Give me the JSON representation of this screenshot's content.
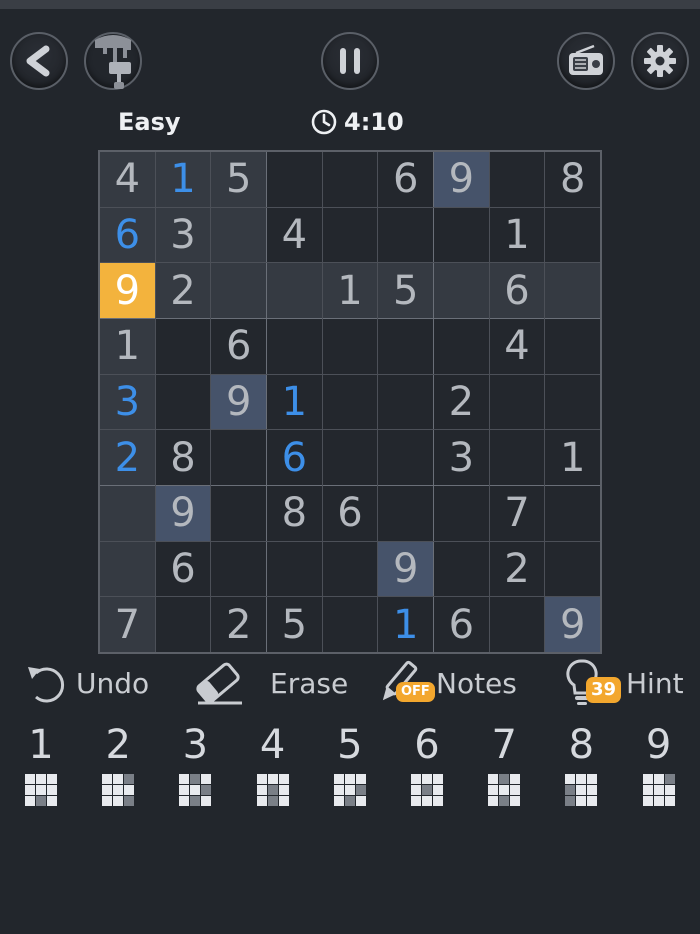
{
  "header": {
    "difficulty": "Easy",
    "timer": "4:10"
  },
  "board": {
    "rows": [
      [
        "4",
        "1",
        "5",
        "",
        "",
        "6",
        "9",
        "",
        "8"
      ],
      [
        "6",
        "3",
        "",
        "4",
        "",
        "",
        "",
        "1",
        ""
      ],
      [
        "9",
        "2",
        "",
        "",
        "1",
        "5",
        "",
        "6",
        ""
      ],
      [
        "1",
        "",
        "6",
        "",
        "",
        "",
        "",
        "4",
        ""
      ],
      [
        "3",
        "",
        "9",
        "1",
        "",
        "",
        "2",
        "",
        ""
      ],
      [
        "2",
        "8",
        "",
        "6",
        "",
        "",
        "3",
        "",
        "1"
      ],
      [
        "",
        "9",
        "",
        "8",
        "6",
        "",
        "",
        "7",
        ""
      ],
      [
        "",
        "6",
        "",
        "",
        "",
        "9",
        "",
        "2",
        ""
      ],
      [
        "7",
        "",
        "2",
        "5",
        "",
        "1",
        "6",
        "",
        "9"
      ]
    ],
    "user_entered": [
      [
        0,
        1
      ],
      [
        1,
        0
      ],
      [
        4,
        0
      ],
      [
        4,
        3
      ],
      [
        5,
        0
      ],
      [
        5,
        3
      ],
      [
        8,
        5
      ]
    ],
    "selected": [
      2,
      0
    ],
    "highlighted_value": "9"
  },
  "tools": {
    "undo": "Undo",
    "erase": "Erase",
    "notes": "Notes",
    "notes_state": "OFF",
    "hint": "Hint",
    "hint_count": "39"
  },
  "numpad": {
    "digits": [
      "1",
      "2",
      "3",
      "4",
      "5",
      "6",
      "7",
      "8",
      "9"
    ],
    "remaining_patterns": [
      [
        1,
        1,
        1,
        1,
        1,
        1,
        1,
        0,
        1
      ],
      [
        1,
        1,
        0,
        1,
        1,
        1,
        1,
        1,
        0
      ],
      [
        1,
        0,
        1,
        1,
        1,
        0,
        1,
        0,
        1
      ],
      [
        1,
        1,
        1,
        1,
        0,
        1,
        1,
        0,
        1
      ],
      [
        1,
        1,
        1,
        1,
        1,
        0,
        1,
        0,
        1
      ],
      [
        1,
        1,
        1,
        1,
        0,
        1,
        1,
        1,
        1
      ],
      [
        1,
        0,
        1,
        1,
        1,
        1,
        1,
        0,
        1
      ],
      [
        1,
        1,
        1,
        0,
        1,
        1,
        0,
        1,
        1
      ],
      [
        1,
        1,
        0,
        1,
        1,
        1,
        1,
        1,
        1
      ]
    ]
  },
  "colors": {
    "background": "#22262c",
    "selected_cell": "#f3b33d",
    "user_digit": "#3d8fe8",
    "badge": "#f3a72e"
  },
  "icons": [
    "back-icon",
    "theme-paint-icon",
    "pause-icon",
    "radio-icon",
    "gear-icon",
    "undo-icon",
    "eraser-icon",
    "pencil-icon",
    "lightbulb-icon",
    "clock-icon"
  ]
}
